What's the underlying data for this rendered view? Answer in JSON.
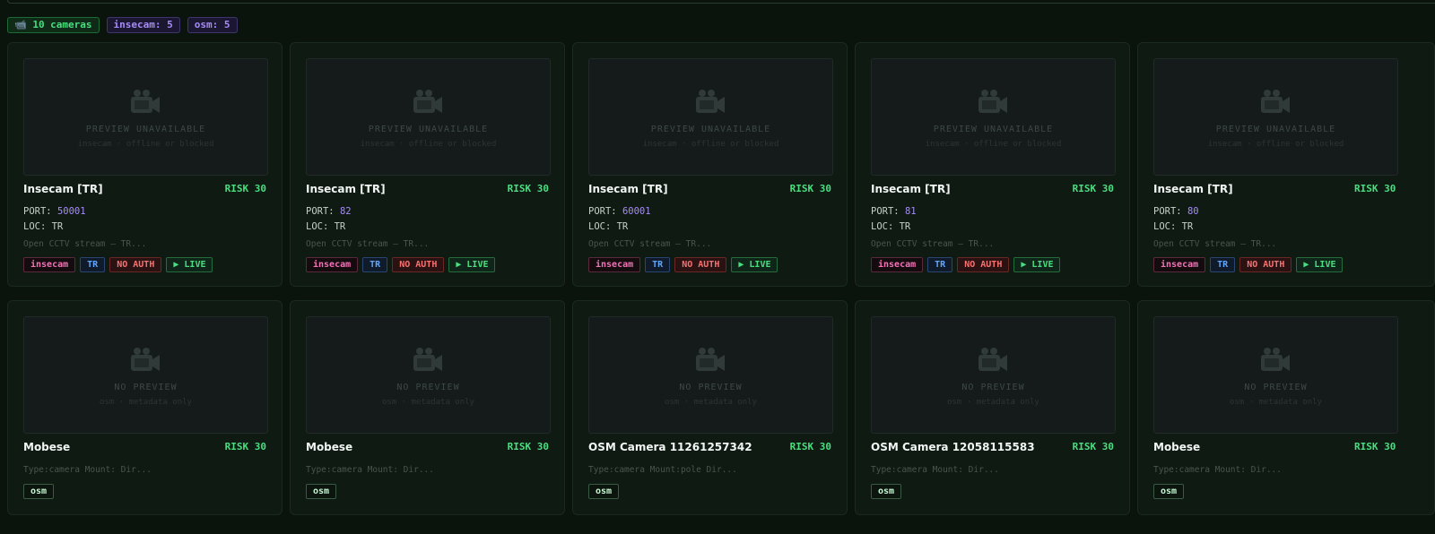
{
  "summary": {
    "count": "📹 10 cameras",
    "insecam": "insecam: 5",
    "osm": "osm: 5"
  },
  "colors": {
    "accent": "#4ade80",
    "port": "#a78bfa",
    "background": "#0b130d"
  },
  "row1": [
    {
      "preview_title": "PREVIEW UNAVAILABLE",
      "preview_sub": "insecam · offline or blocked",
      "title": "Insecam [TR]",
      "risk": "RISK 30",
      "port_label": "PORT:",
      "port": "50001",
      "loc": "LOC: TR",
      "desc": "Open CCTV stream — TR...",
      "tags": [
        "insecam",
        "TR",
        "NO AUTH",
        "▶ LIVE"
      ]
    },
    {
      "preview_title": "PREVIEW UNAVAILABLE",
      "preview_sub": "insecam · offline or blocked",
      "title": "Insecam [TR]",
      "risk": "RISK 30",
      "port_label": "PORT:",
      "port": "82",
      "loc": "LOC: TR",
      "desc": "Open CCTV stream — TR...",
      "tags": [
        "insecam",
        "TR",
        "NO AUTH",
        "▶ LIVE"
      ]
    },
    {
      "preview_title": "PREVIEW UNAVAILABLE",
      "preview_sub": "insecam · offline or blocked",
      "title": "Insecam [TR]",
      "risk": "RISK 30",
      "port_label": "PORT:",
      "port": "60001",
      "loc": "LOC: TR",
      "desc": "Open CCTV stream — TR...",
      "tags": [
        "insecam",
        "TR",
        "NO AUTH",
        "▶ LIVE"
      ]
    },
    {
      "preview_title": "PREVIEW UNAVAILABLE",
      "preview_sub": "insecam · offline or blocked",
      "title": "Insecam [TR]",
      "risk": "RISK 30",
      "port_label": "PORT:",
      "port": "81",
      "loc": "LOC: TR",
      "desc": "Open CCTV stream — TR...",
      "tags": [
        "insecam",
        "TR",
        "NO AUTH",
        "▶ LIVE"
      ]
    },
    {
      "preview_title": "PREVIEW UNAVAILABLE",
      "preview_sub": "insecam · offline or blocked",
      "title": "Insecam [TR]",
      "risk": "RISK 30",
      "port_label": "PORT:",
      "port": "80",
      "loc": "LOC: TR",
      "desc": "Open CCTV stream — TR...",
      "tags": [
        "insecam",
        "TR",
        "NO AUTH",
        "▶ LIVE"
      ]
    }
  ],
  "row2": [
    {
      "preview_title": "NO PREVIEW",
      "preview_sub": "osm · metadata only",
      "title": "Mobese",
      "risk": "RISK 30",
      "desc": "Type:camera Mount: Dir...",
      "tag": "osm"
    },
    {
      "preview_title": "NO PREVIEW",
      "preview_sub": "osm · metadata only",
      "title": "Mobese",
      "risk": "RISK 30",
      "desc": "Type:camera Mount: Dir...",
      "tag": "osm"
    },
    {
      "preview_title": "NO PREVIEW",
      "preview_sub": "osm · metadata only",
      "title": "OSM Camera 11261257342",
      "risk": "RISK 30",
      "desc": "Type:camera Mount:pole Dir...",
      "tag": "osm"
    },
    {
      "preview_title": "NO PREVIEW",
      "preview_sub": "osm · metadata only",
      "title": "OSM Camera 12058115583",
      "risk": "RISK 30",
      "desc": "Type:camera Mount: Dir...",
      "tag": "osm"
    },
    {
      "preview_title": "NO PREVIEW",
      "preview_sub": "osm · metadata only",
      "title": "Mobese",
      "risk": "RISK 30",
      "desc": "Type:camera Mount: Dir...",
      "tag": "osm"
    }
  ]
}
